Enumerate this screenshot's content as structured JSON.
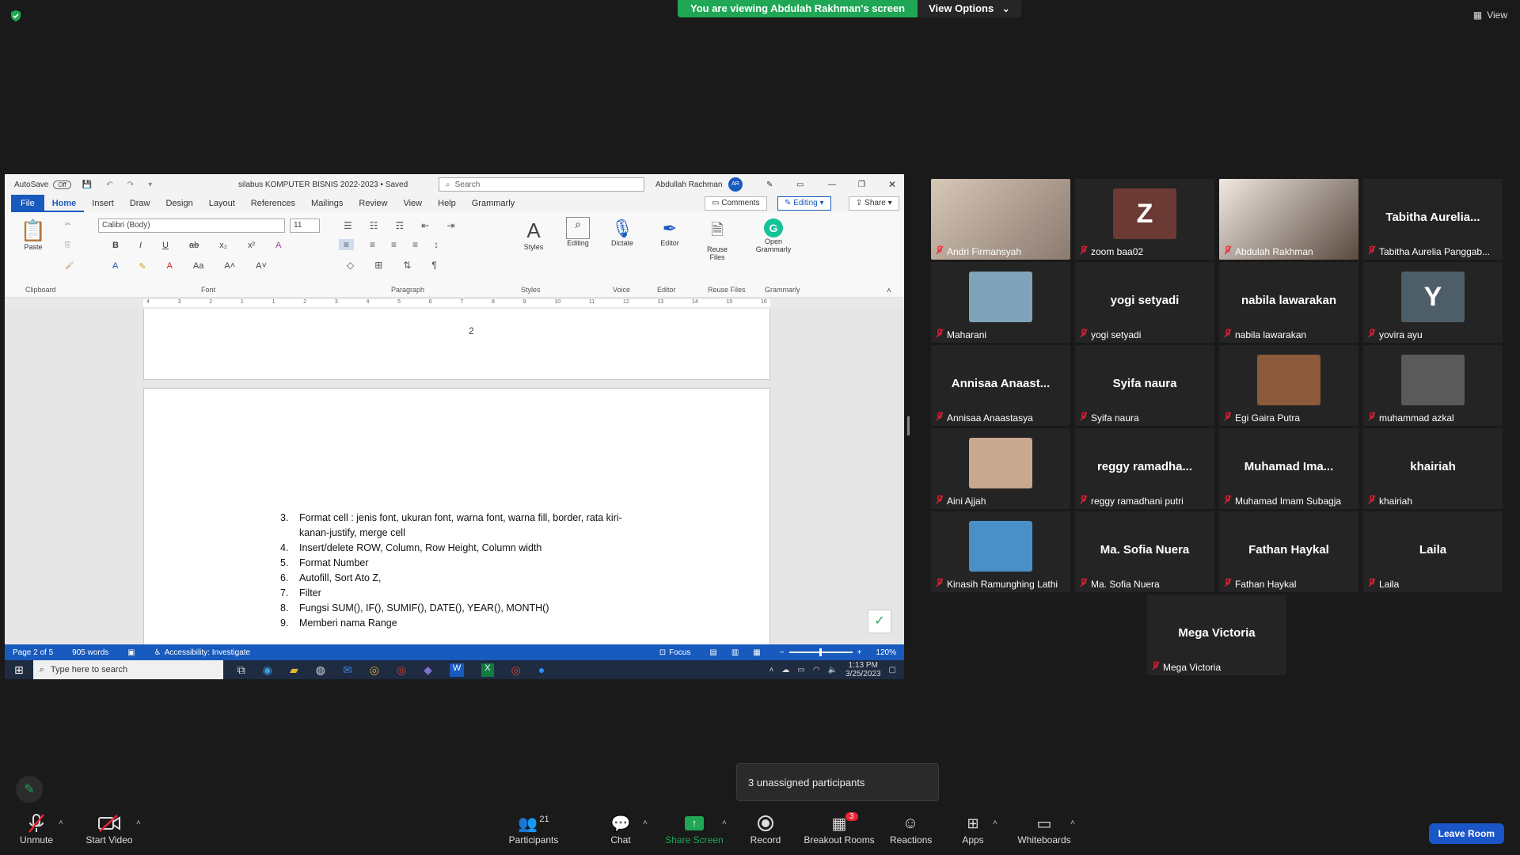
{
  "top": {
    "banner": "You are viewing Abdulah Rakhman's screen",
    "view_options": "View Options",
    "view": "View"
  },
  "word": {
    "autosave": "AutoSave",
    "autosave_state": "Off",
    "doc_title": "silabus KOMPUTER BISNIS 2022-2023 • Saved",
    "search_placeholder": "Search",
    "user": "Abdullah Rachman",
    "user_initials": "AR",
    "tabs": [
      "File",
      "Home",
      "Insert",
      "Draw",
      "Design",
      "Layout",
      "References",
      "Mailings",
      "Review",
      "View",
      "Help",
      "Grammarly"
    ],
    "comments": "Comments",
    "editing_btn": "Editing",
    "share": "Share",
    "font_name": "Calibri (Body)",
    "font_size": "11",
    "groups": {
      "clipboard": "Clipboard",
      "font": "Font",
      "paragraph": "Paragraph",
      "styles": "Styles",
      "voice": "Voice",
      "editor": "Editor",
      "reuse": "Reuse Files",
      "grammarly": "Grammarly"
    },
    "buttons": {
      "paste": "Paste",
      "styles": "Styles",
      "editing": "Editing",
      "dictate": "Dictate",
      "editor": "Editor",
      "reuse1": "Reuse",
      "reuse2": "Files",
      "grammarly1": "Open",
      "grammarly2": "Grammarly"
    },
    "ruler": [
      "4",
      "3",
      "2",
      "1",
      "1",
      "2",
      "3",
      "4",
      "5",
      "6",
      "7",
      "8",
      "9",
      "10",
      "11",
      "12",
      "13",
      "14",
      "15",
      "16"
    ],
    "page_number": "2",
    "list": [
      {
        "n": "3.",
        "text": "Format cell : jenis font, ukuran font, warna font, warna fill, border, rata kiri-",
        "cont": "kanan-justify, merge cell"
      },
      {
        "n": "4.",
        "text": "Insert/delete ROW, Column, Row Height, Column width"
      },
      {
        "n": "5.",
        "text": "Format Number"
      },
      {
        "n": "6.",
        "text": "Autofill, Sort Ato Z,"
      },
      {
        "n": "7.",
        "text": "Filter"
      },
      {
        "n": "8.",
        "text": "Fungsi SUM(), IF(), SUMIF(), DATE(), YEAR(), MONTH()"
      },
      {
        "n": "9.",
        "text": "Memberi nama Range"
      }
    ],
    "status": {
      "page": "Page 2 of 5",
      "words": "905 words",
      "accessibility": "Accessibility: Investigate",
      "focus": "Focus",
      "zoom": "120%"
    },
    "taskbar": {
      "search": "Type here to search",
      "time": "1:13 PM",
      "date": "3/25/2023"
    }
  },
  "participants": [
    {
      "name": "Andri Firmansyah",
      "big": "",
      "type": "video",
      "color": "#8a7a70"
    },
    {
      "name": "zoom baa02",
      "big": "Z",
      "type": "avatar",
      "color": "#6b3a35"
    },
    {
      "name": "Abdulah Rakhman",
      "big": "",
      "type": "video-active",
      "color": "#5a4a40"
    },
    {
      "name": "Tabitha Aurelia Panggab...",
      "big": "Tabitha  Aurelia...",
      "type": "text",
      "color": ""
    },
    {
      "name": "Maharani",
      "big": "",
      "type": "photo",
      "color": "#7fa3b8"
    },
    {
      "name": "yogi setyadi",
      "big": "yogi setyadi",
      "type": "text",
      "color": ""
    },
    {
      "name": "nabila lawarakan",
      "big": "nabila lawarakan",
      "type": "text",
      "color": ""
    },
    {
      "name": "yovira ayu",
      "big": "Y",
      "type": "avatar",
      "color": "#4e5e68"
    },
    {
      "name": "Annisaa Anaastasya",
      "big": "Annisaa  Anaast...",
      "type": "text",
      "color": ""
    },
    {
      "name": "Syifa naura",
      "big": "Syifa naura",
      "type": "text",
      "color": ""
    },
    {
      "name": "Egi Gaira Putra",
      "big": "",
      "type": "photo",
      "color": "#8a5a3a"
    },
    {
      "name": "muhammad azkal",
      "big": "",
      "type": "photo",
      "color": "#5a5a5a"
    },
    {
      "name": "Aini Ajjah",
      "big": "",
      "type": "photo",
      "color": "#c9a890"
    },
    {
      "name": "reggy ramadhani putri",
      "big": "reggy  ramadha...",
      "type": "text",
      "color": ""
    },
    {
      "name": "Muhamad Imam Subagja",
      "big": "Muhamad  Ima...",
      "type": "text",
      "color": ""
    },
    {
      "name": "khairiah",
      "big": "khairiah",
      "type": "text",
      "color": ""
    },
    {
      "name": "Kinasih Ramunghing Lathi",
      "big": "",
      "type": "photo",
      "color": "#4a90c8"
    },
    {
      "name": "Ma. Sofia Nuera",
      "big": "Ma. Sofia Nuera",
      "type": "text",
      "color": ""
    },
    {
      "name": "Fathan Haykal",
      "big": "Fathan Haykal",
      "type": "text",
      "color": ""
    },
    {
      "name": "Laila",
      "big": "Laila",
      "type": "text",
      "color": ""
    },
    {
      "name": "Mega Victoria",
      "big": "Mega Victoria",
      "type": "text",
      "color": ""
    }
  ],
  "notice": "3 unassigned participants",
  "toolbar": {
    "unmute": "Unmute",
    "start_video": "Start Video",
    "participants": "Participants",
    "participants_count": "21",
    "chat": "Chat",
    "share_screen": "Share Screen",
    "record": "Record",
    "breakout": "Breakout Rooms",
    "breakout_badge": "3",
    "reactions": "Reactions",
    "apps": "Apps",
    "whiteboards": "Whiteboards",
    "leave": "Leave Room"
  }
}
